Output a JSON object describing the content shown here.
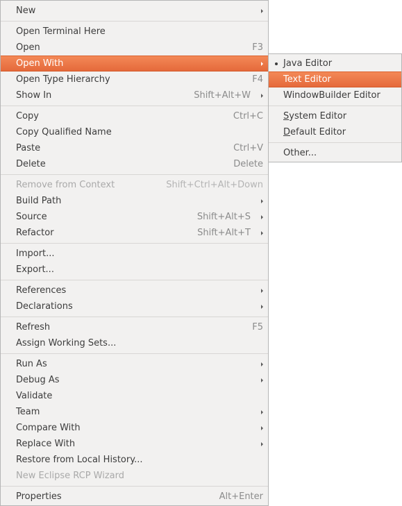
{
  "main_menu": {
    "groups": [
      [
        {
          "label": "New",
          "submenu": true
        }
      ],
      [
        {
          "label": "Open Terminal Here"
        },
        {
          "label": "Open",
          "shortcut": "F3"
        },
        {
          "label": "Open With",
          "submenu": true,
          "active": true
        },
        {
          "label": "Open Type Hierarchy",
          "shortcut": "F4"
        },
        {
          "label": "Show In",
          "shortcut": "Shift+Alt+W",
          "submenu": true
        }
      ],
      [
        {
          "label": "Copy",
          "shortcut": "Ctrl+C"
        },
        {
          "label": "Copy Qualified Name"
        },
        {
          "label": "Paste",
          "shortcut": "Ctrl+V"
        },
        {
          "label": "Delete",
          "shortcut": "Delete"
        }
      ],
      [
        {
          "label": "Remove from Context",
          "shortcut": "Shift+Ctrl+Alt+Down",
          "disabled": true
        },
        {
          "label": "Build Path",
          "submenu": true
        },
        {
          "label": "Source",
          "shortcut": "Shift+Alt+S",
          "submenu": true
        },
        {
          "label": "Refactor",
          "shortcut": "Shift+Alt+T",
          "submenu": true
        }
      ],
      [
        {
          "label": "Import..."
        },
        {
          "label": "Export..."
        }
      ],
      [
        {
          "label": "References",
          "submenu": true
        },
        {
          "label": "Declarations",
          "submenu": true
        }
      ],
      [
        {
          "label": "Refresh",
          "shortcut": "F5"
        },
        {
          "label": "Assign Working Sets..."
        }
      ],
      [
        {
          "label": "Run As",
          "submenu": true
        },
        {
          "label": "Debug As",
          "submenu": true
        },
        {
          "label": "Validate"
        },
        {
          "label": "Team",
          "submenu": true
        },
        {
          "label": "Compare With",
          "submenu": true
        },
        {
          "label": "Replace With",
          "submenu": true
        },
        {
          "label": "Restore from Local History..."
        },
        {
          "label": "New Eclipse RCP Wizard",
          "disabled": true
        }
      ],
      [
        {
          "label": "Properties",
          "shortcut": "Alt+Enter"
        }
      ]
    ]
  },
  "open_with_submenu": {
    "groups": [
      [
        {
          "label": "Java Editor",
          "selected": true
        },
        {
          "label": "Text Editor",
          "active": true
        },
        {
          "label": "WindowBuilder Editor"
        }
      ],
      [
        {
          "label": "System Editor",
          "mnemonic": "S",
          "rest": "ystem Editor"
        },
        {
          "label": "Default Editor",
          "mnemonic": "D",
          "rest": "efault Editor"
        }
      ],
      [
        {
          "label": "Other..."
        }
      ]
    ]
  },
  "colors": {
    "menu_background": "#f2f1f0",
    "highlight": "#e86e40",
    "text": "#3c3c3c",
    "disabled_text": "#a9a9a9",
    "shortcut_text": "#8b8b8b"
  }
}
